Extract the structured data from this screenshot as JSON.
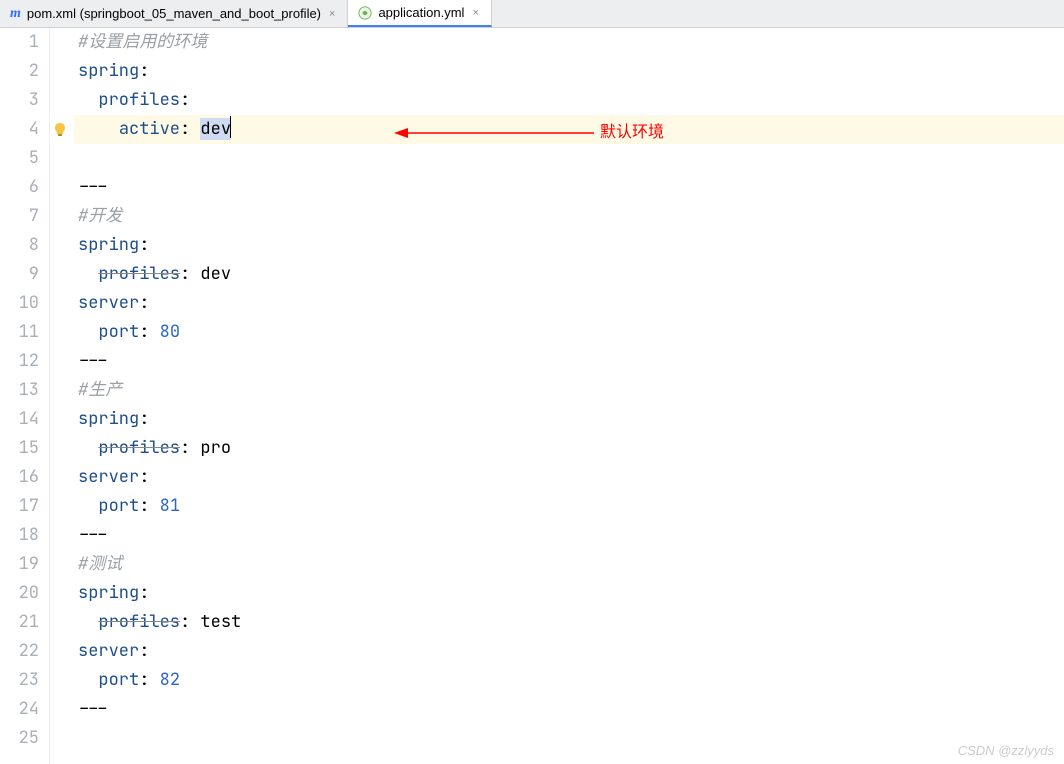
{
  "tabs": [
    {
      "icon": "maven-icon",
      "label": "pom.xml (springboot_05_maven_and_boot_profile)",
      "active": false
    },
    {
      "icon": "yml-icon",
      "label": "application.yml",
      "active": true
    }
  ],
  "close_glyph": "×",
  "annotation": "默认环境",
  "watermark": "CSDN @zzlyyds",
  "lines": [
    {
      "n": 1,
      "segs": [
        {
          "t": "#设置启用的环境",
          "cls": "comment"
        }
      ]
    },
    {
      "n": 2,
      "segs": [
        {
          "t": "spring",
          "cls": "kw"
        },
        {
          "t": ":",
          "cls": ""
        }
      ]
    },
    {
      "n": 3,
      "segs": [
        {
          "t": "  ",
          "cls": ""
        },
        {
          "t": "profiles",
          "cls": "kw"
        },
        {
          "t": ":",
          "cls": ""
        }
      ]
    },
    {
      "n": 4,
      "hl": true,
      "bulb": true,
      "arrow": true,
      "segs": [
        {
          "t": "    ",
          "cls": ""
        },
        {
          "t": "active",
          "cls": "kw"
        },
        {
          "t": ": ",
          "cls": ""
        },
        {
          "t": "dev",
          "cls": "sel"
        }
      ],
      "caret": true
    },
    {
      "n": 5,
      "segs": []
    },
    {
      "n": 6,
      "segs": [
        {
          "t": "---",
          "cls": ""
        }
      ]
    },
    {
      "n": 7,
      "segs": [
        {
          "t": "#开发",
          "cls": "comment"
        }
      ]
    },
    {
      "n": 8,
      "segs": [
        {
          "t": "spring",
          "cls": "kw"
        },
        {
          "t": ":",
          "cls": ""
        }
      ]
    },
    {
      "n": 9,
      "segs": [
        {
          "t": "  ",
          "cls": ""
        },
        {
          "t": "profiles",
          "cls": "kw strike"
        },
        {
          "t": ": dev",
          "cls": ""
        }
      ]
    },
    {
      "n": 10,
      "segs": [
        {
          "t": "server",
          "cls": "kw"
        },
        {
          "t": ":",
          "cls": ""
        }
      ]
    },
    {
      "n": 11,
      "segs": [
        {
          "t": "  ",
          "cls": ""
        },
        {
          "t": "port",
          "cls": "kw"
        },
        {
          "t": ": ",
          "cls": ""
        },
        {
          "t": "80",
          "cls": "num"
        }
      ]
    },
    {
      "n": 12,
      "segs": [
        {
          "t": "---",
          "cls": ""
        }
      ]
    },
    {
      "n": 13,
      "segs": [
        {
          "t": "#生产",
          "cls": "comment"
        }
      ]
    },
    {
      "n": 14,
      "segs": [
        {
          "t": "spring",
          "cls": "kw"
        },
        {
          "t": ":",
          "cls": ""
        }
      ]
    },
    {
      "n": 15,
      "segs": [
        {
          "t": "  ",
          "cls": ""
        },
        {
          "t": "profiles",
          "cls": "kw strike"
        },
        {
          "t": ": pro",
          "cls": ""
        }
      ]
    },
    {
      "n": 16,
      "segs": [
        {
          "t": "server",
          "cls": "kw"
        },
        {
          "t": ":",
          "cls": ""
        }
      ]
    },
    {
      "n": 17,
      "segs": [
        {
          "t": "  ",
          "cls": ""
        },
        {
          "t": "port",
          "cls": "kw"
        },
        {
          "t": ": ",
          "cls": ""
        },
        {
          "t": "81",
          "cls": "num"
        }
      ]
    },
    {
      "n": 18,
      "segs": [
        {
          "t": "---",
          "cls": ""
        }
      ]
    },
    {
      "n": 19,
      "segs": [
        {
          "t": "#测试",
          "cls": "comment"
        }
      ]
    },
    {
      "n": 20,
      "segs": [
        {
          "t": "spring",
          "cls": "kw"
        },
        {
          "t": ":",
          "cls": ""
        }
      ]
    },
    {
      "n": 21,
      "segs": [
        {
          "t": "  ",
          "cls": ""
        },
        {
          "t": "profiles",
          "cls": "kw strike"
        },
        {
          "t": ": test",
          "cls": ""
        }
      ]
    },
    {
      "n": 22,
      "segs": [
        {
          "t": "server",
          "cls": "kw"
        },
        {
          "t": ":",
          "cls": ""
        }
      ]
    },
    {
      "n": 23,
      "segs": [
        {
          "t": "  ",
          "cls": ""
        },
        {
          "t": "port",
          "cls": "kw"
        },
        {
          "t": ": ",
          "cls": ""
        },
        {
          "t": "82",
          "cls": "num"
        }
      ]
    },
    {
      "n": 24,
      "segs": [
        {
          "t": "---",
          "cls": ""
        }
      ]
    },
    {
      "n": 25,
      "segs": []
    }
  ]
}
